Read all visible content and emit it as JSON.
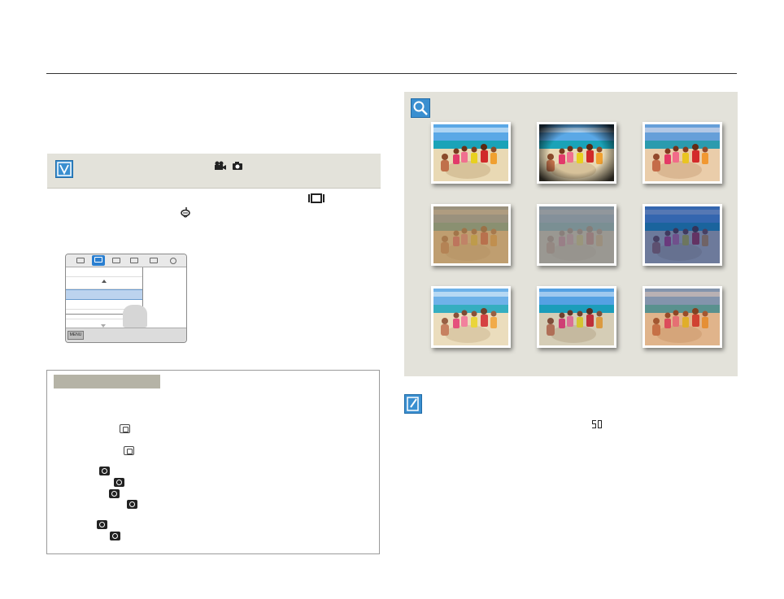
{
  "menu_screen": {
    "menu_button_label": "MENU"
  },
  "photo_effects": [
    {
      "name": "normal",
      "tint": "#ffffff",
      "tint_opacity": 0,
      "vignette": false
    },
    {
      "name": "vignette",
      "tint": "#000000",
      "tint_opacity": 0,
      "vignette": true
    },
    {
      "name": "vivid",
      "tint": "#ff4040",
      "tint_opacity": 0.08,
      "vignette": false
    },
    {
      "name": "sepia",
      "tint": "#b08a5a",
      "tint_opacity": 0.75,
      "vignette": false
    },
    {
      "name": "black-white",
      "tint": "#8c8c8c",
      "tint_opacity": 0.85,
      "vignette": false
    },
    {
      "name": "negative",
      "tint": "#1a3a8a",
      "tint_opacity": 0.6,
      "vignette": false
    },
    {
      "name": "pastel",
      "tint": "#ffffff",
      "tint_opacity": 0.12,
      "vignette": false
    },
    {
      "name": "cool",
      "tint": "#2a6ad0",
      "tint_opacity": 0.1,
      "vignette": false
    },
    {
      "name": "warm",
      "tint": "#d07040",
      "tint_opacity": 0.35,
      "vignette": false
    }
  ],
  "colors": {
    "accent": "#3a8fd0",
    "panel_bg": "#e3e2da",
    "note_label_bg": "#b5b3a6"
  },
  "icons": {
    "check": "check-icon",
    "video_mode": "movie-camera-icon",
    "photo_mode": "camera-icon",
    "display": "display-icon",
    "scene": "diver-mask-icon",
    "magnify": "magnifier-icon",
    "memo": "pencil-note-icon"
  }
}
